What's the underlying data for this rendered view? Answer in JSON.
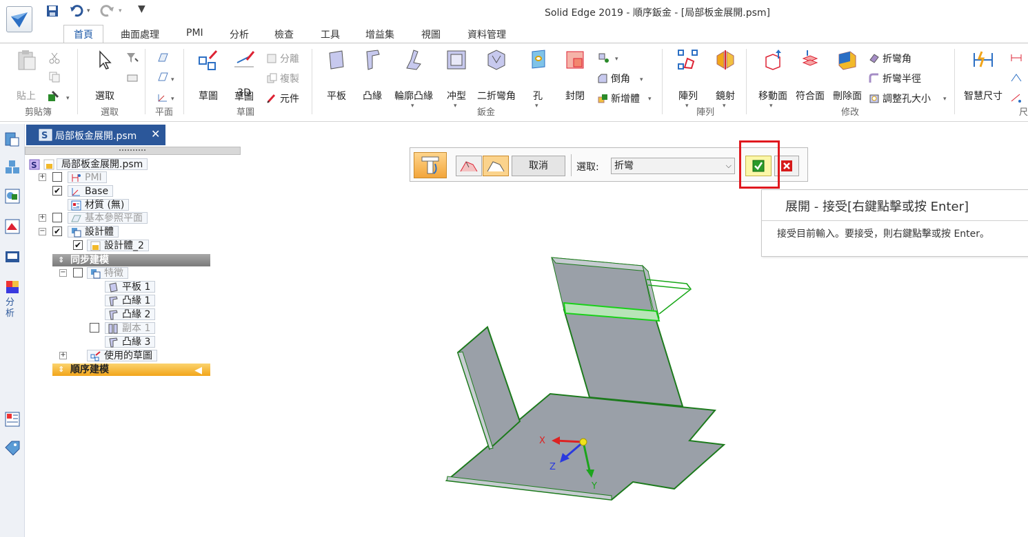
{
  "app": {
    "title": "Solid Edge 2019 - 順序鈑金 - [局部板金展開.psm]"
  },
  "tabs": [
    {
      "label": "首頁",
      "active": true
    },
    {
      "label": "曲面處理"
    },
    {
      "label": "PMI"
    },
    {
      "label": "分析"
    },
    {
      "label": "檢查"
    },
    {
      "label": "工具"
    },
    {
      "label": "增益集"
    },
    {
      "label": "視圖"
    },
    {
      "label": "資料管理"
    }
  ],
  "ribbon": {
    "paste": "貼上",
    "clipboard_group": "剪貼簿",
    "select": "選取",
    "select_group": "選取",
    "plane_group": "平面",
    "sketch": "草圖",
    "sketch3d": "3D",
    "sketch3d_line2": "草圖",
    "sketch_group": "草圖",
    "split": "分離",
    "copy": "複製",
    "component": "元件",
    "flange_plate": "平板",
    "flange": "凸緣",
    "contour_flange": "輪廓凸緣",
    "punch": "冲型",
    "double_bend": "二折彎角",
    "hole": "孔",
    "close": "封閉",
    "chamfer": "倒角",
    "new_body": "新增體",
    "sheetmetal_group": "鈑金",
    "pattern": "陣列",
    "mirror": "鏡射",
    "pattern_group": "陣列",
    "move_face": "移動面",
    "coincident_face": "符合面",
    "delete_face": "刪除面",
    "bend_angle": "折彎角",
    "bend_radius": "折彎半徑",
    "resize_hole": "調整孔大小",
    "modify_group": "修改",
    "smart_dim": "智慧尺寸",
    "dim_group_fragment": "尺"
  },
  "left_bar": {
    "analysis_label": "分析"
  },
  "document": {
    "tab_label": "局部板金展開.psm"
  },
  "tree": {
    "root": "局部板金展開.psm",
    "pmi": "PMI",
    "base": "Base",
    "material": "材質 (無)",
    "ref_planes": "基本參照平面",
    "design_body": "設計體",
    "design_body_2": "設計體_2",
    "sync_modeling": "同步建模",
    "features": "特徵",
    "plate1": "平板 1",
    "flange1": "凸緣 1",
    "flange2": "凸緣 2",
    "copy1": "副本 1",
    "flange3": "凸緣 3",
    "used_sketches": "使用的草圖",
    "ordered_modeling": "順序建模"
  },
  "command_bar": {
    "cancel": "取消",
    "select_label": "選取:",
    "select_value": "折彎"
  },
  "tooltip": {
    "title": "展開 - 接受[右鍵點擊或按 Enter]",
    "body": "接受目前輸入。要接受，則右鍵點擊或按 Enter。"
  },
  "triad": {
    "x": "X",
    "y": "Y",
    "z": "Z"
  },
  "colors": {
    "accent_blue": "#2b579a",
    "highlight_red": "#e0181e",
    "accept_yellow": "#fbf7a8",
    "model_gray": "#9aa0a8",
    "edge_green": "#1c7a1c",
    "ordered_bar": "#f7b52f"
  }
}
